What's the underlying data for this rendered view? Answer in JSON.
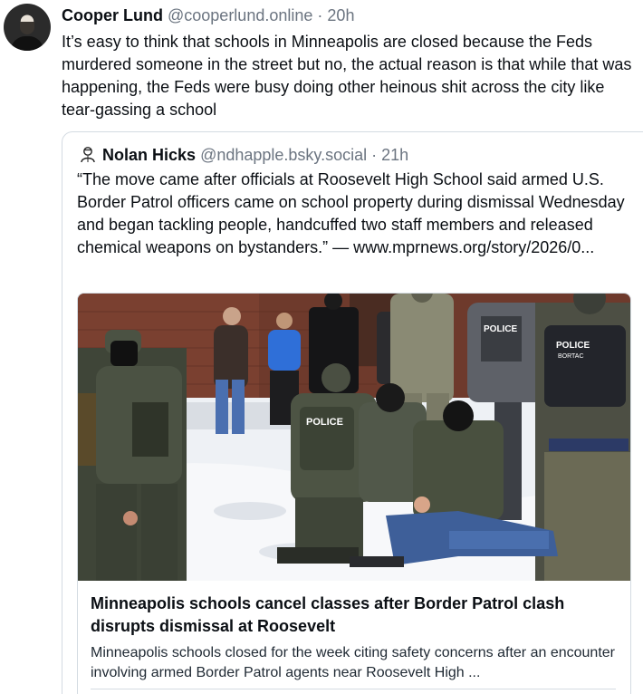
{
  "post": {
    "author": {
      "display_name": "Cooper Lund",
      "handle": "@cooperlund.online",
      "separator": "·",
      "time": "20h"
    },
    "text": "It’s easy to think that schools in Minneapolis are closed because the Feds murdered someone in the street but no, the actual reason is that while that was happening, the Feds were busy doing other heinous shit across the city like tear-gassing a school"
  },
  "quote": {
    "author": {
      "display_name": "Nolan Hicks",
      "handle": "@ndhapple.bsky.social",
      "separator": "·",
      "time": "21h"
    },
    "text": "“The move came after officials at Roosevelt High School said armed U.S. Border Patrol officers came on school property during dismissal Wednesday and began tackling people, handcuffed two staff members and released chemical weapons on bystanders.” — www.mprnews.org/story/2026/0...",
    "card": {
      "image_labels": {
        "vest_left": "POLICE",
        "vest_right": "POLICE",
        "vest_right_sub": "BORTAC",
        "vest_top": "POLICE"
      },
      "title": "Minneapolis schools cancel classes after Border Patrol clash disrupts dismissal at Roosevelt",
      "description": "Minneapolis schools closed for the week citing safety concerns after an encounter involving armed Border Patrol agents near Roosevelt High ..."
    }
  }
}
